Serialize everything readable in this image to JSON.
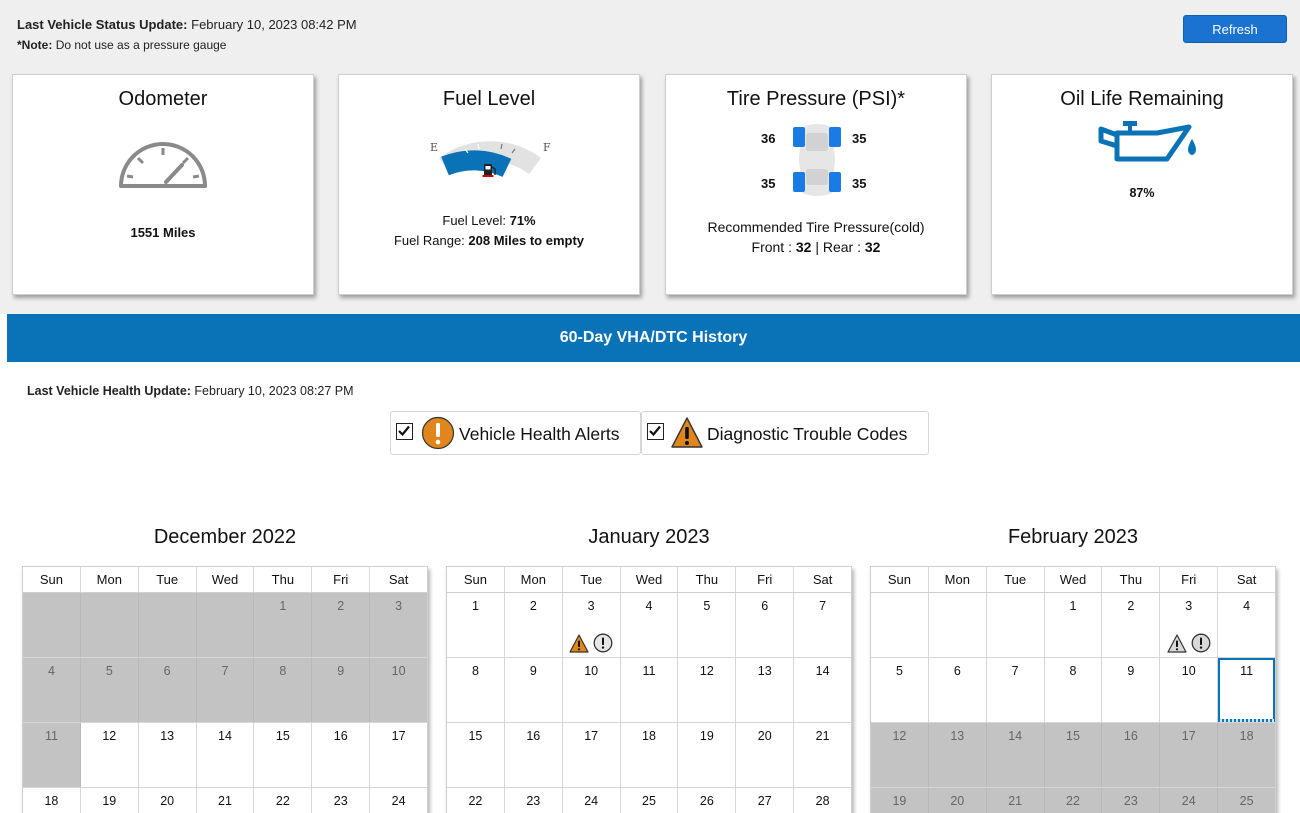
{
  "status": {
    "update_label": "Last Vehicle Status Update:",
    "update_value": "February 10, 2023 08:42 PM",
    "note_label": "*Note:",
    "note_value": "Do not use as a pressure gauge",
    "refresh_label": "Refresh"
  },
  "cards": {
    "odometer": {
      "title": "Odometer",
      "value": "1551 Miles"
    },
    "fuel": {
      "title": "Fuel Level",
      "gauge_e": "E",
      "gauge_f": "F",
      "level_label": "Fuel Level:",
      "level_value": "71%",
      "level_fraction": 0.71,
      "range_label": "Fuel Range:",
      "range_value": "208 Miles to empty"
    },
    "tire": {
      "title": "Tire Pressure (PSI)*",
      "front_left": "36",
      "front_right": "35",
      "rear_left": "35",
      "rear_right": "35",
      "recommended_label": "Recommended Tire Pressure(cold)",
      "front_label": "Front :",
      "front_value": "32",
      "separator": "|",
      "rear_label": "Rear :",
      "rear_value": "32"
    },
    "oil": {
      "title": "Oil Life Remaining",
      "value": "87%"
    }
  },
  "history": {
    "banner": "60-Day VHA/DTC History",
    "update_label": "Last Vehicle Health Update:",
    "update_value": "February 10, 2023 08:27 PM",
    "filters": {
      "vha_label": "Vehicle Health Alerts",
      "dtc_label": "Diagnostic Trouble Codes"
    }
  },
  "weekdays": [
    "Sun",
    "Mon",
    "Tue",
    "Wed",
    "Thu",
    "Fri",
    "Sat"
  ],
  "calendars": [
    {
      "title": "December 2022",
      "weeks": [
        [
          {
            "n": "",
            "s": "grey"
          },
          {
            "n": "",
            "s": "grey"
          },
          {
            "n": "",
            "s": "grey"
          },
          {
            "n": "",
            "s": "grey"
          },
          {
            "n": "1",
            "s": "grey"
          },
          {
            "n": "2",
            "s": "grey"
          },
          {
            "n": "3",
            "s": "grey"
          }
        ],
        [
          {
            "n": "4",
            "s": "grey"
          },
          {
            "n": "5",
            "s": "grey"
          },
          {
            "n": "6",
            "s": "grey"
          },
          {
            "n": "7",
            "s": "grey"
          },
          {
            "n": "8",
            "s": "grey"
          },
          {
            "n": "9",
            "s": "grey"
          },
          {
            "n": "10",
            "s": "grey"
          }
        ],
        [
          {
            "n": "11",
            "s": "grey"
          },
          {
            "n": "12"
          },
          {
            "n": "13"
          },
          {
            "n": "14"
          },
          {
            "n": "15"
          },
          {
            "n": "16"
          },
          {
            "n": "17"
          }
        ],
        [
          {
            "n": "18"
          },
          {
            "n": "19"
          },
          {
            "n": "20"
          },
          {
            "n": "21"
          },
          {
            "n": "22"
          },
          {
            "n": "23"
          },
          {
            "n": "24"
          }
        ]
      ]
    },
    {
      "title": "January 2023",
      "weeks": [
        [
          {
            "n": "1"
          },
          {
            "n": "2"
          },
          {
            "n": "3",
            "a": [
              "dtc",
              "vha"
            ]
          },
          {
            "n": "4"
          },
          {
            "n": "5"
          },
          {
            "n": "6"
          },
          {
            "n": "7"
          }
        ],
        [
          {
            "n": "8"
          },
          {
            "n": "9"
          },
          {
            "n": "10"
          },
          {
            "n": "11"
          },
          {
            "n": "12"
          },
          {
            "n": "13"
          },
          {
            "n": "14"
          }
        ],
        [
          {
            "n": "15"
          },
          {
            "n": "16"
          },
          {
            "n": "17"
          },
          {
            "n": "18"
          },
          {
            "n": "19"
          },
          {
            "n": "20"
          },
          {
            "n": "21"
          }
        ],
        [
          {
            "n": "22"
          },
          {
            "n": "23"
          },
          {
            "n": "24"
          },
          {
            "n": "25"
          },
          {
            "n": "26"
          },
          {
            "n": "27"
          },
          {
            "n": "28"
          }
        ]
      ]
    },
    {
      "title": "February 2023",
      "weeks": [
        [
          {
            "n": "",
            "s": "empty"
          },
          {
            "n": "",
            "s": "empty"
          },
          {
            "n": "",
            "s": "empty"
          },
          {
            "n": "1"
          },
          {
            "n": "2"
          },
          {
            "n": "3",
            "a": [
              "dtc-grey",
              "vha-grey"
            ]
          },
          {
            "n": "4"
          }
        ],
        [
          {
            "n": "5"
          },
          {
            "n": "6"
          },
          {
            "n": "7"
          },
          {
            "n": "8"
          },
          {
            "n": "9"
          },
          {
            "n": "10"
          },
          {
            "n": "11",
            "s": "today"
          }
        ],
        [
          {
            "n": "12",
            "s": "grey"
          },
          {
            "n": "13",
            "s": "grey"
          },
          {
            "n": "14",
            "s": "grey"
          },
          {
            "n": "15",
            "s": "grey"
          },
          {
            "n": "16",
            "s": "grey"
          },
          {
            "n": "17",
            "s": "grey"
          },
          {
            "n": "18",
            "s": "grey"
          }
        ],
        [
          {
            "n": "19",
            "s": "grey"
          },
          {
            "n": "20",
            "s": "grey"
          },
          {
            "n": "21",
            "s": "grey"
          },
          {
            "n": "22",
            "s": "grey"
          },
          {
            "n": "23",
            "s": "grey"
          },
          {
            "n": "24",
            "s": "grey"
          },
          {
            "n": "25",
            "s": "grey"
          }
        ]
      ]
    }
  ],
  "colors": {
    "accent_blue": "#0a73b8",
    "button_blue": "#1a73d0",
    "alert_orange": "#e0861c",
    "grey_day": "#c3c3c3"
  }
}
